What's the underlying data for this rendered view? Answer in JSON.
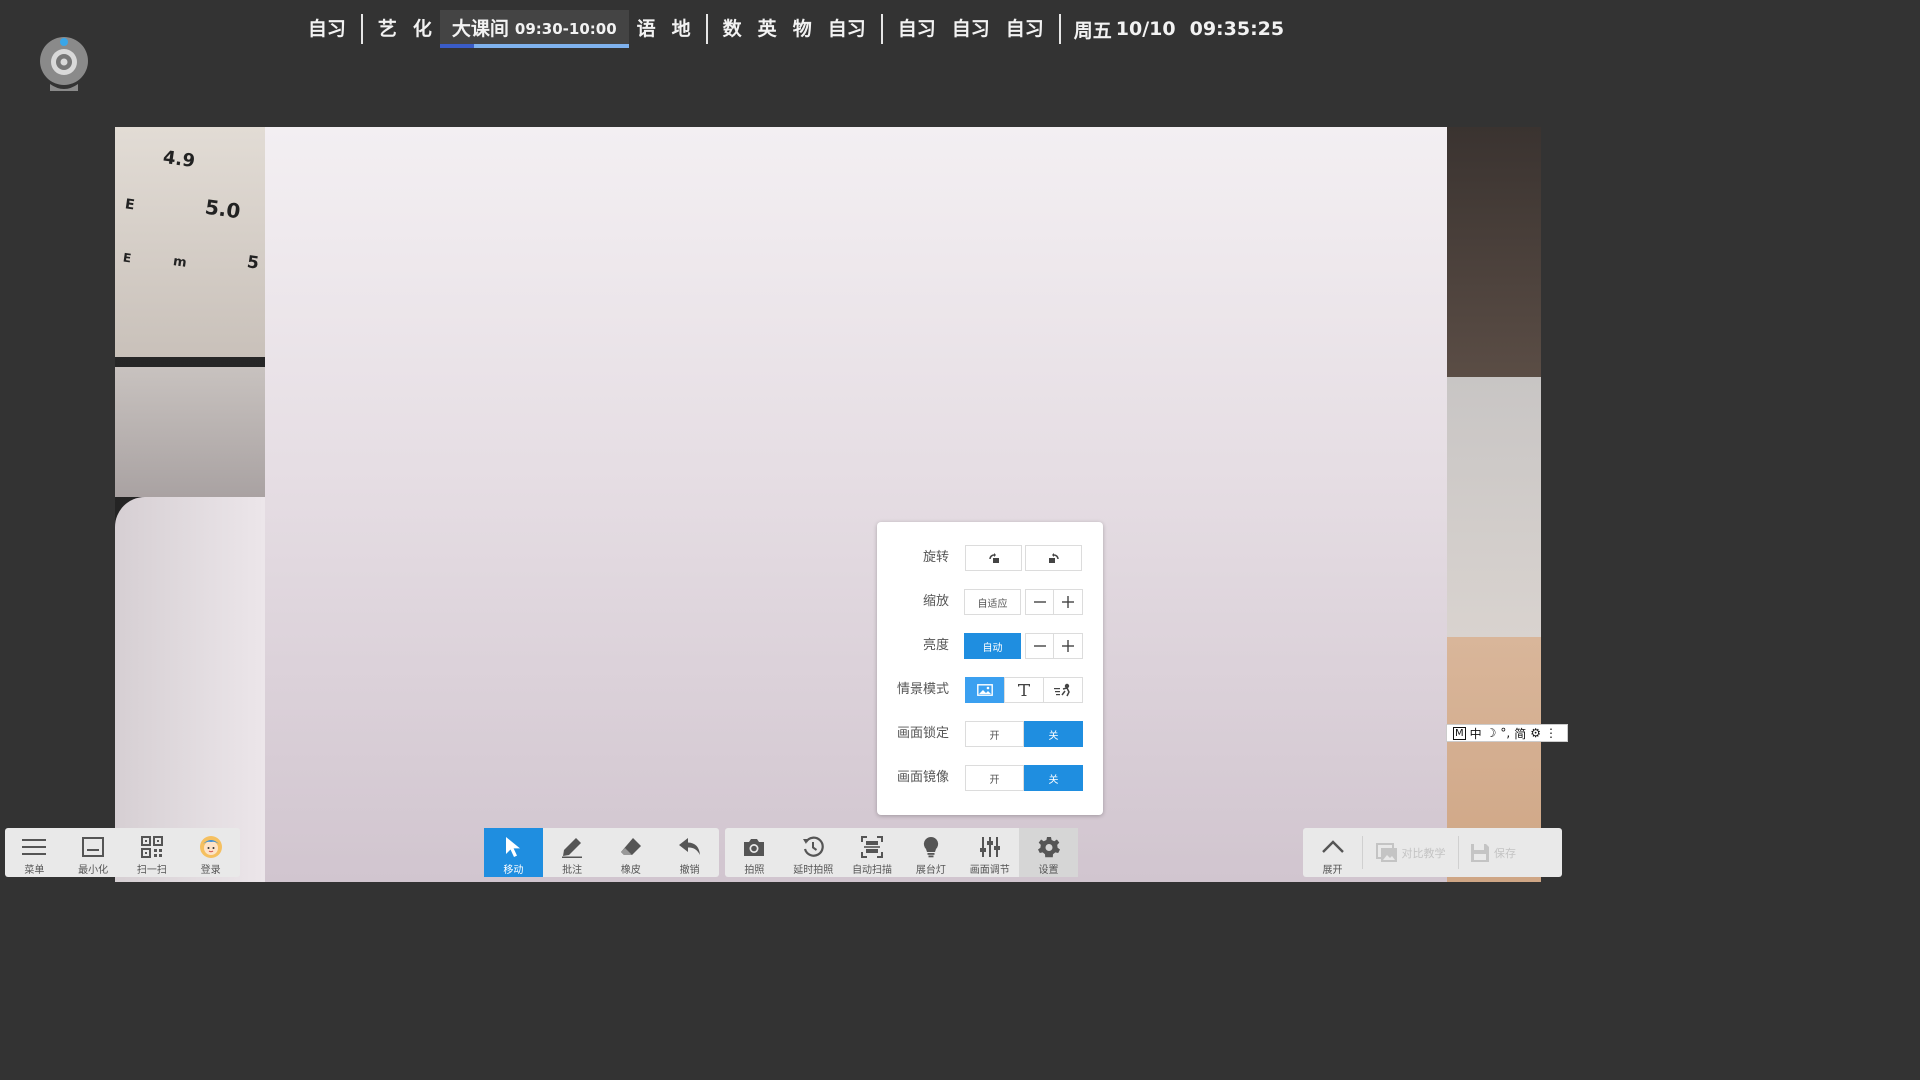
{
  "schedule": {
    "groups": [
      [
        "自习"
      ],
      [
        "艺",
        "化"
      ],
      [
        "语",
        "地"
      ],
      [
        "数",
        "英",
        "物",
        "自习"
      ],
      [
        "自习",
        "自习",
        "自习"
      ]
    ],
    "current": {
      "label": "大课间",
      "time": "09:30-10:00",
      "progress": 0.18
    },
    "day": "周五",
    "date": "10/10",
    "clock": "09:35:25"
  },
  "settings": {
    "rotate": {
      "label": "旋转",
      "left_icon": "rotate-left-icon",
      "right_icon": "rotate-right-icon"
    },
    "zoom": {
      "label": "缩放",
      "fit": "自适应"
    },
    "brightness": {
      "label": "亮度",
      "auto": "自动"
    },
    "scene": {
      "label": "情景模式",
      "modes": [
        "scene-photo-icon",
        "scene-text-icon",
        "scene-motion-icon"
      ],
      "selected": 0
    },
    "lock": {
      "label": "画面锁定",
      "on": "开",
      "off": "关",
      "value": "off"
    },
    "mirror": {
      "label": "画面镜像",
      "on": "开",
      "off": "关",
      "value": "off"
    }
  },
  "ime": {
    "mode": "M",
    "lang": "中",
    "moon": "☽",
    "punct": "°,",
    "script": "简",
    "gear": "⚙",
    "more": "⋮"
  },
  "toolbar_left": [
    {
      "label": "菜单",
      "icon": "menu-icon"
    },
    {
      "label": "最小化",
      "icon": "minimize-icon"
    },
    {
      "label": "扫一扫",
      "icon": "qr-code-icon"
    },
    {
      "label": "登录",
      "icon": "avatar-icon"
    }
  ],
  "toolbar_tools": [
    {
      "label": "移动",
      "icon": "cursor-icon",
      "active": true
    },
    {
      "label": "批注",
      "icon": "pen-icon"
    },
    {
      "label": "橡皮",
      "icon": "eraser-icon"
    },
    {
      "label": "撤销",
      "icon": "undo-icon"
    }
  ],
  "toolbar_camera": [
    {
      "label": "拍照",
      "icon": "camera-icon"
    },
    {
      "label": "延时拍照",
      "icon": "timer-icon"
    },
    {
      "label": "自动扫描",
      "icon": "scan-icon"
    },
    {
      "label": "展台灯",
      "icon": "lamp-icon"
    },
    {
      "label": "画面调节",
      "icon": "sliders-icon"
    },
    {
      "label": "设置",
      "icon": "gear-icon",
      "selected": true
    }
  ],
  "toolbar_right": [
    {
      "label": "展开",
      "icon": "chevron-up-icon"
    },
    {
      "label": "对比教学",
      "icon": "compare-icon",
      "disabled": true
    },
    {
      "label": "保存",
      "icon": "save-icon",
      "disabled": true
    }
  ],
  "preview_ruler": [
    "4.9",
    "5.0",
    "E",
    "m",
    "5",
    "E"
  ],
  "colors": {
    "accent": "#1f8ee0",
    "background": "#333333",
    "toolbar": "#e9e9e9"
  }
}
